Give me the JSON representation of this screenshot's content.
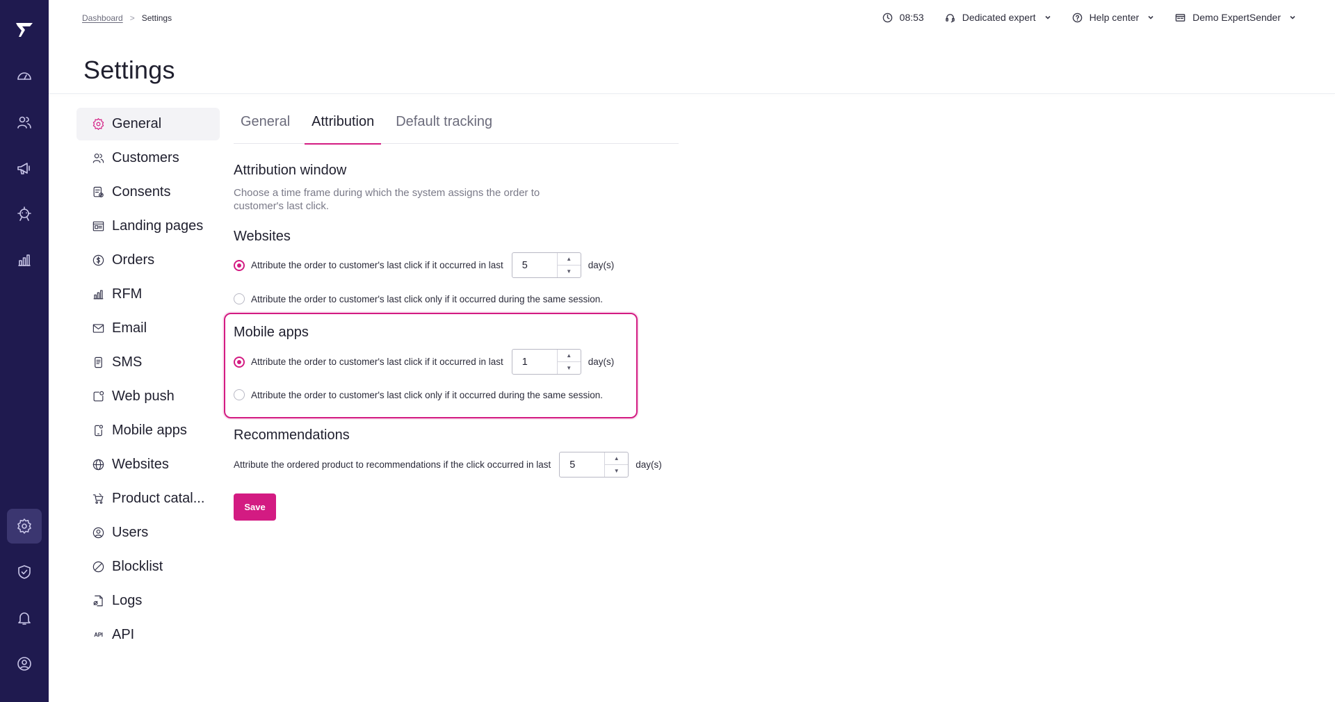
{
  "header": {
    "breadcrumb": {
      "link": "Dashboard",
      "separator": ">",
      "current": "Settings"
    },
    "title": "Settings",
    "time": "08:53",
    "dedicated_expert": "Dedicated expert",
    "help_center": "Help center",
    "account": "Demo ExpertSender"
  },
  "rail": {
    "items": [
      "logo-icon",
      "dashboard-icon",
      "customers-icon",
      "campaigns-icon",
      "automation-icon",
      "analytics-icon",
      "settings-icon",
      "security-icon",
      "notifications-icon",
      "account-icon"
    ],
    "active": "settings-icon"
  },
  "nav": {
    "items": [
      {
        "label": "General",
        "icon": "gear-icon",
        "active": true
      },
      {
        "label": "Customers",
        "icon": "users-icon"
      },
      {
        "label": "Consents",
        "icon": "consents-icon"
      },
      {
        "label": "Landing pages",
        "icon": "landing-pages-icon"
      },
      {
        "label": "Orders",
        "icon": "dollar-icon"
      },
      {
        "label": "RFM",
        "icon": "bar-chart-icon"
      },
      {
        "label": "Email",
        "icon": "mail-icon"
      },
      {
        "label": "SMS",
        "icon": "phone-icon"
      },
      {
        "label": "Web push",
        "icon": "web-push-icon"
      },
      {
        "label": "Mobile apps",
        "icon": "mobile-icon"
      },
      {
        "label": "Websites",
        "icon": "globe-icon"
      },
      {
        "label": "Product catal...",
        "icon": "cart-icon"
      },
      {
        "label": "Users",
        "icon": "user-circle-icon"
      },
      {
        "label": "Blocklist",
        "icon": "block-icon"
      },
      {
        "label": "Logs",
        "icon": "logs-icon"
      },
      {
        "label": "API",
        "icon": "api-icon"
      }
    ]
  },
  "tabs": [
    {
      "label": "General",
      "active": false
    },
    {
      "label": "Attribution",
      "active": true
    },
    {
      "label": "Default tracking",
      "active": false
    }
  ],
  "attribution": {
    "title": "Attribution window",
    "description": "Choose a time frame during which the system assigns the order to customer's last click."
  },
  "websites": {
    "title": "Websites",
    "option_last": "Attribute the order to customer's last click if it occurred in last",
    "option_session": "Attribute the order to customer's last click only if it occurred during the same session.",
    "days": "5",
    "unit": "day(s)",
    "selected": "last"
  },
  "mobile": {
    "title": "Mobile apps",
    "option_last": "Attribute the order to customer's last click if it occurred in last",
    "option_session": "Attribute the order to customer's last click only if it occurred during the same session.",
    "days": "1",
    "unit": "day(s)",
    "selected": "last"
  },
  "recommendations": {
    "title": "Recommendations",
    "label": "Attribute the ordered product to recommendations if the click occurred in last",
    "days": "5",
    "unit": "day(s)"
  },
  "save_label": "Save",
  "colors": {
    "accent": "#d31b82",
    "rail": "#1f1a4f"
  }
}
